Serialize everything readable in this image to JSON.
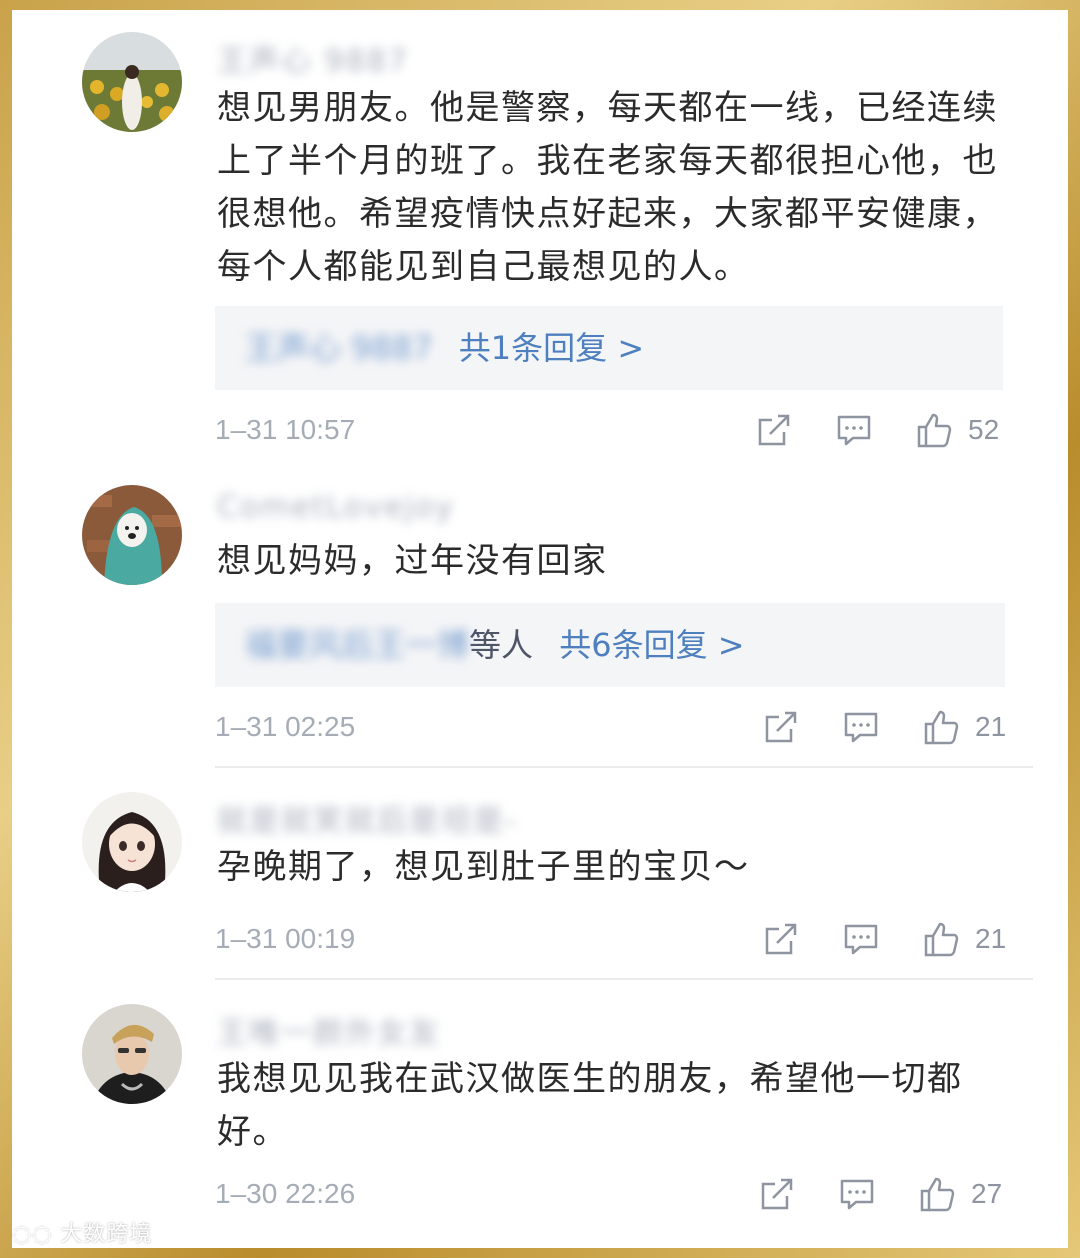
{
  "watermark": "大数跨境",
  "comments": [
    {
      "username": "王声心 9887",
      "text": "想见男朋友。他是警察，每天都在一线，已经连续上了半个月的班了。我在老家每天都很担心他，也很想他。希望疫情快点好起来，大家都平安健康，每个人都能见到自己最想见的人。",
      "reply_users": "王声心 9887",
      "reply_etc": "",
      "reply_count": "共1条回复 >",
      "time": "1–31 10:57",
      "likes": "52"
    },
    {
      "username": "CometLovejoy",
      "text": "想见妈妈，过年没有回家",
      "reply_users": "福要风后王一博",
      "reply_etc": "等人",
      "reply_count": "共6条回复 >",
      "time": "1–31 02:25",
      "likes": "21"
    },
    {
      "username": "就是就笑就后是坦是-",
      "text": "孕晚期了，想见到肚子里的宝贝～",
      "time": "1–31 00:19",
      "likes": "21"
    },
    {
      "username": "王唯一颜外女友",
      "text": "我想见见我在武汉做医生的朋友，希望他一切都好。",
      "time": "1–30 22:26",
      "likes": "27"
    }
  ],
  "icons": {
    "share": "share-icon",
    "comment": "comment-icon",
    "like": "like-icon"
  }
}
